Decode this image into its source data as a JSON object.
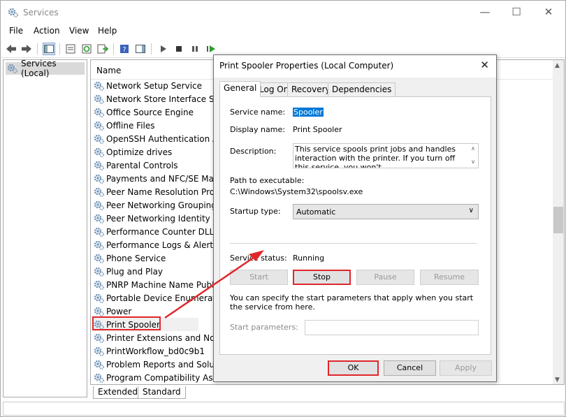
{
  "window": {
    "title": "Services",
    "minimize_glyph": "—",
    "maximize_glyph": "☐",
    "close_glyph": "✕"
  },
  "menu": [
    "File",
    "Action",
    "View",
    "Help"
  ],
  "toolbar_icons": [
    "back-icon",
    "forward-icon",
    "show-console-tree-icon",
    "properties-icon",
    "refresh-icon",
    "export-list-icon",
    "help-icon",
    "action-pane-icon",
    "start-service-icon",
    "stop-service-icon",
    "pause-service-icon",
    "restart-service-icon"
  ],
  "tree": {
    "item": "Services (Local)"
  },
  "list": {
    "column_name": "Name",
    "rows": [
      "Network Setup Service",
      "Network Store Interface Servi",
      "Office  Source Engine",
      "Offline Files",
      "OpenSSH Authentication Age",
      "Optimize drives",
      "Parental Controls",
      "Payments and NFC/SE Manag",
      "Peer Name Resolution Protoc",
      "Peer Networking Grouping",
      "Peer Networking Identity Mar",
      "Performance Counter DLL Ho",
      "Performance Logs & Alerts",
      "Phone Service",
      "Plug and Play",
      "PNRP Machine Name Publica",
      "Portable Device Enumerator S",
      "Power",
      "Print Spooler",
      "Printer Extensions and Notific",
      "PrintWorkflow_bd0c9b1",
      "Problem Reports and Solutior",
      "Program Compatibility Assist"
    ],
    "highlighted_row": "Print Spooler"
  },
  "bottom_tabs": [
    "Extended",
    "Standard"
  ],
  "dialog": {
    "title": "Print Spooler Properties (Local Computer)",
    "close_glyph": "✕",
    "tabs": [
      "General",
      "Log On",
      "Recovery",
      "Dependencies"
    ],
    "active_tab": "General",
    "service_name_label": "Service name:",
    "service_name_value": "Spooler",
    "display_name_label": "Display name:",
    "display_name_value": "Print Spooler",
    "description_label": "Description:",
    "description_value": "This service spools print jobs and handles interaction with the printer.  If you turn off this service, you won't",
    "path_label": "Path to executable:",
    "path_value": "C:\\Windows\\System32\\spoolsv.exe",
    "startup_type_label": "Startup type:",
    "startup_type_value": "Automatic",
    "service_status_label": "Service status:",
    "service_status_value": "Running",
    "buttons": {
      "start": "Start",
      "stop": "Stop",
      "pause": "Pause",
      "resume": "Resume"
    },
    "hint": "You can specify the start parameters that apply when you start the service from here.",
    "start_params_label": "Start parameters:",
    "start_params_value": "",
    "ok": "OK",
    "cancel": "Cancel",
    "apply": "Apply"
  },
  "colors": {
    "highlight_red": "#e0262b",
    "selection_blue": "#0078d7"
  }
}
